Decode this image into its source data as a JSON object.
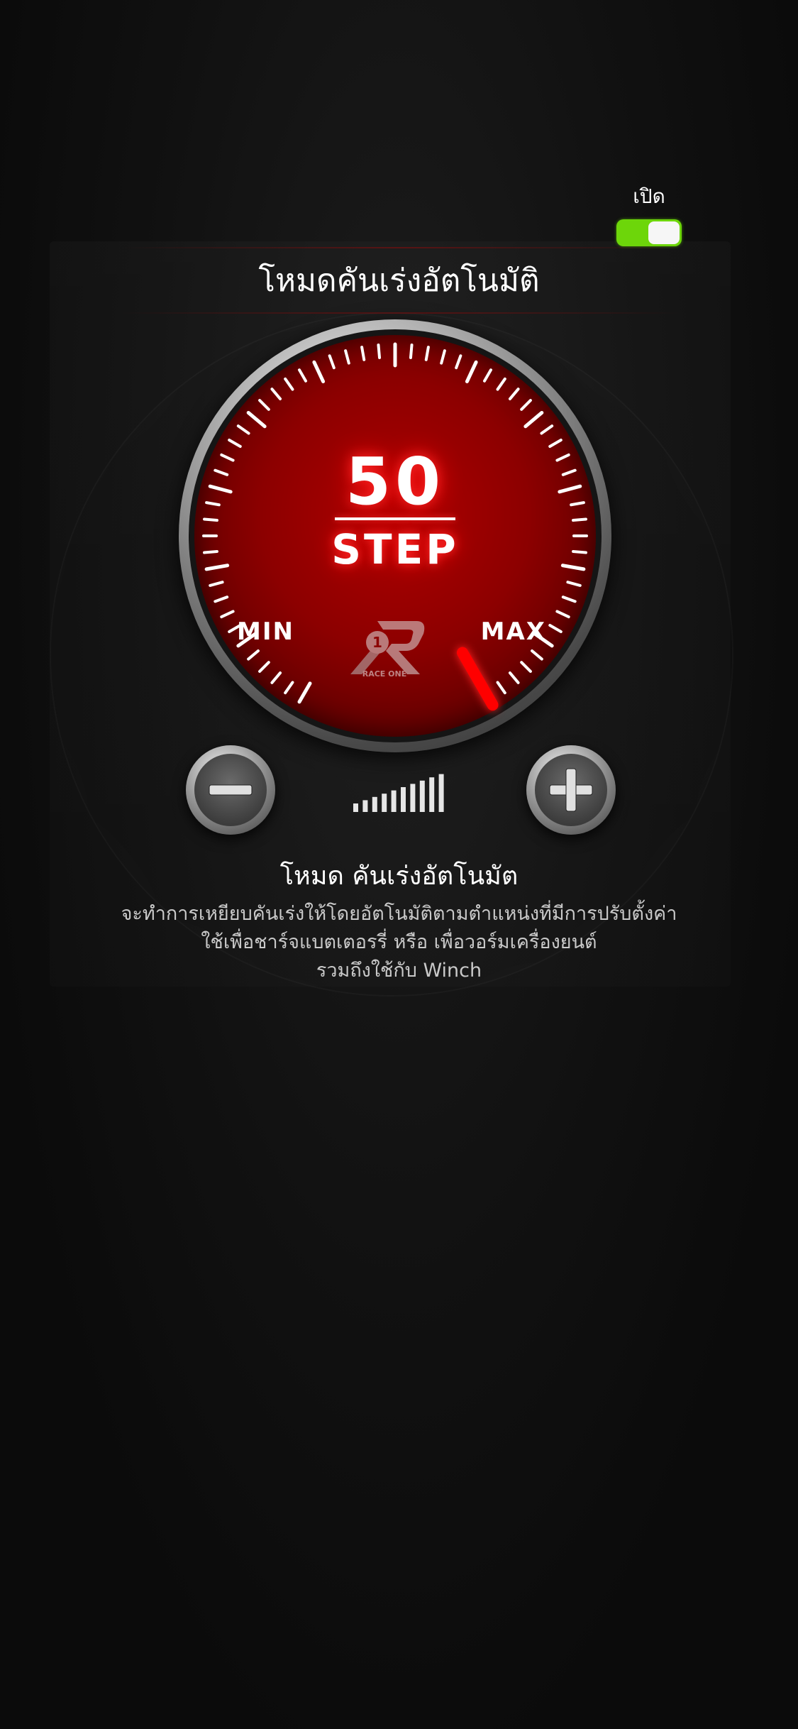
{
  "toggle": {
    "label": "เปิด",
    "on": true,
    "on_color": "#6dd60a"
  },
  "page_title": "โหมดคันเร่งอัตโนมัติ",
  "gauge": {
    "value": "50",
    "unit": "STEP",
    "min_label": "MIN",
    "max_label": "MAX",
    "level_fraction": 1.0,
    "face_color": "#8c0000",
    "needle_color": "#ff0000"
  },
  "logo": {
    "icon": "race-one-logo",
    "text": "RACE ONE"
  },
  "controls": {
    "decrease_icon": "minus-icon",
    "increase_icon": "plus-icon",
    "level_bars_count": 10
  },
  "description": {
    "title": "โหมด คันเร่งอัตโนมัต",
    "lines": [
      "จะทำการเหยียบคันเร่งให้โดยอัตโนมัติตามตำแหน่งที่มีการปรับตั้งค่า",
      "ใช้เพื่อชาร์จแบตเตอรรี่ หรือ เพื่อวอร์มเครื่องยนต์",
      "รวมถึงใช้กับ Winch"
    ]
  }
}
